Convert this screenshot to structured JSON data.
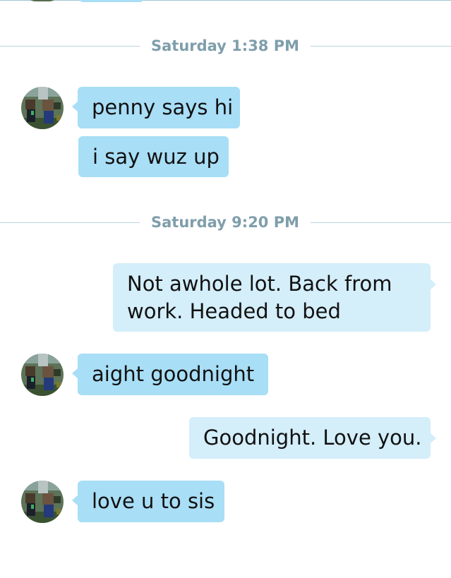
{
  "conversation": {
    "separators": [
      {
        "label": "Saturday 1:38 PM"
      },
      {
        "label": "Saturday 9:20 PM"
      }
    ],
    "messages": [
      {
        "direction": "incoming",
        "text": "penny says hi"
      },
      {
        "direction": "incoming",
        "text": "i say wuz up"
      },
      {
        "direction": "outgoing",
        "lines": [
          "Not awhole lot. Back from",
          "work. Headed to bed"
        ]
      },
      {
        "direction": "incoming",
        "text": "aight goodnight"
      },
      {
        "direction": "outgoing",
        "text": "Goodnight. Love you."
      },
      {
        "direction": "incoming",
        "text": "love u to sis"
      }
    ]
  },
  "colors": {
    "incoming_bubble": "#a8def6",
    "outgoing_bubble": "#d4eefa",
    "timestamp_text": "#7f9eab",
    "separator_line": "#b8d3de"
  },
  "icons": {
    "avatar": "contact-avatar-icon"
  }
}
